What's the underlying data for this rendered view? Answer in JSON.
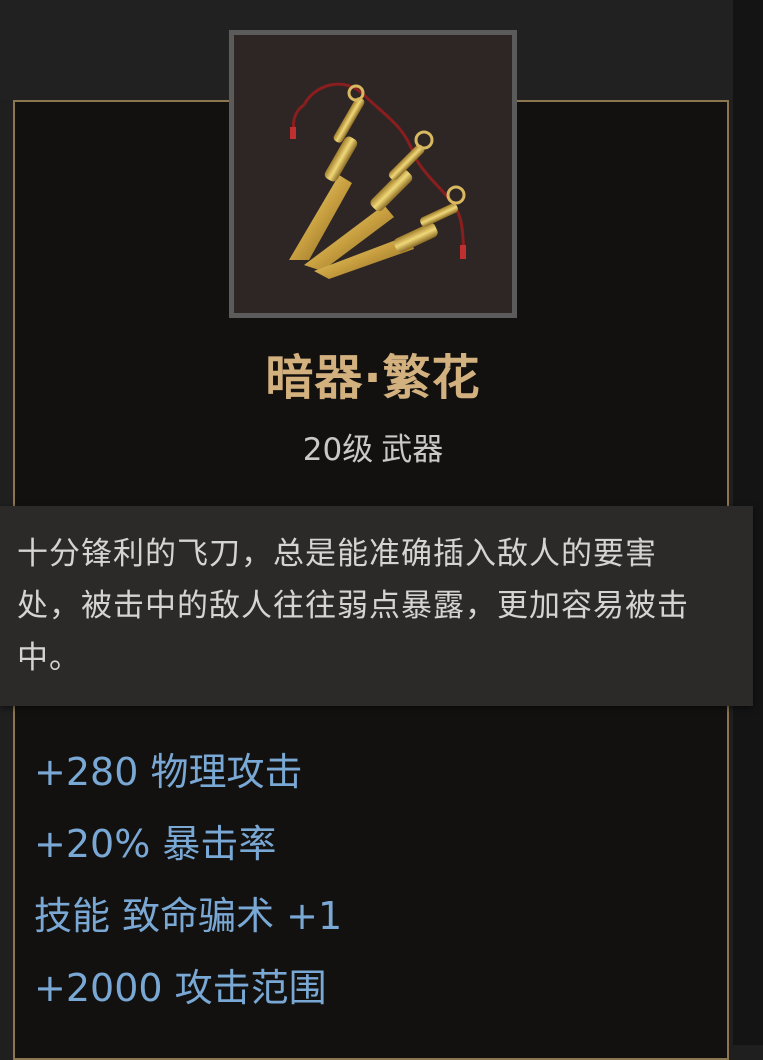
{
  "item": {
    "name": "暗器·繁花",
    "level": "20级",
    "type": "武器",
    "icon": "throwing-knives-icon",
    "description": "十分锋利的飞刀，总是能准确插入敌人的要害处，被击中的敌人往往弱点暴露，更加容易被击中。",
    "stats": [
      "+280 物理攻击",
      "+20% 暴击率",
      "技能 致命骗术 +1",
      "+2000 攻击范围"
    ]
  },
  "colors": {
    "name": "#d3b17f",
    "stat": "#7aa8d4",
    "border": "#8c7650",
    "description_bg": "#2b2a28"
  }
}
